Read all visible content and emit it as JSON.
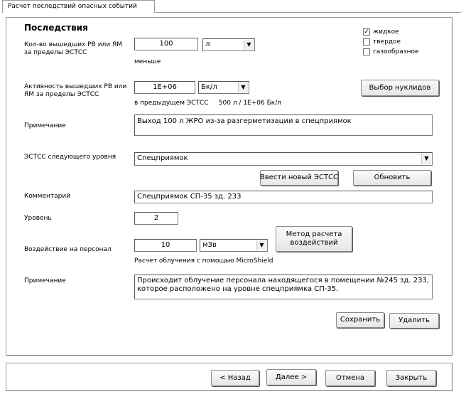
{
  "tab": {
    "label": "Расчет последствий опасных событий"
  },
  "section": {
    "title": "Последствия"
  },
  "state": {
    "options": [
      {
        "label": "жидкое",
        "checked": true
      },
      {
        "label": "твердое",
        "checked": false
      },
      {
        "label": "газообразное",
        "checked": false
      }
    ]
  },
  "quantity": {
    "label": "Кол-во вышедших РВ или ЯМ за пределы ЭСТСС",
    "value": "100",
    "unit": "л",
    "note": "меньше"
  },
  "activity": {
    "label": "Активность вышедших РВ или ЯМ за пределы ЭСТСС",
    "value": "1E+06",
    "unit": "Бк/л",
    "note": "в предыдущем ЭСТСС     500 л / 1Е+06 Бк/л",
    "nuclide_button": "Выбор нуклидов"
  },
  "note1": {
    "label": "Примечание",
    "text": "Выход 100 л ЖРО из-за разгерметизации в спецприямок"
  },
  "next_level": {
    "label": "ЭСТСС следующего уровня",
    "value": "Спецприямок",
    "new_button": "Ввести новый ЭСТСС",
    "refresh_button": "Обновить"
  },
  "comment": {
    "label": "Комментарий",
    "value": "Спецприямок СП-35 зд. 233"
  },
  "level": {
    "label": "Уровень",
    "value": "2"
  },
  "exposure": {
    "label": "Воздействие на персонал",
    "value": "10",
    "unit": "мЗв",
    "note": "Расчет облучения с помощью MicroShield",
    "method_button": "Метод расчета воздействий"
  },
  "note2": {
    "label": "Примечание",
    "text": "Происходит облучение персонала находящегося в помещении №245 зд. 233, которое расположено на уровне спецприямка СП-35."
  },
  "actions": {
    "save": "Сохранить",
    "delete": "Удалить"
  },
  "footer": {
    "back": "< Назад",
    "next": "Далее >",
    "cancel": "Отмена",
    "close": "Закрыть"
  }
}
